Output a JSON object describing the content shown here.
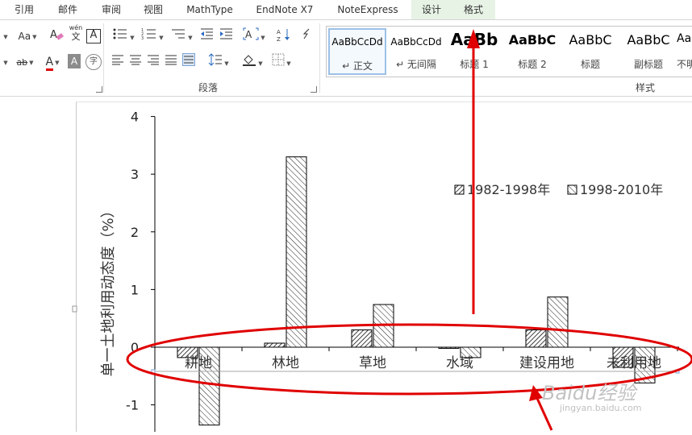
{
  "tabs": [
    "引用",
    "邮件",
    "审阅",
    "视图",
    "MathType",
    "EndNote X7",
    "NoteExpress",
    "设计",
    "格式"
  ],
  "ribbon": {
    "font_group": {
      "aa_label": "Aa",
      "phonetic_label": "wén",
      "phonetic_sub": "文",
      "border_char": "A",
      "highlight_label": "ab",
      "font_color_label": "A",
      "shade_char": "A",
      "enclose_char": "字"
    },
    "paragraph_group": {
      "label": "段落"
    },
    "styles_group": {
      "label": "样式",
      "items": [
        {
          "sample": "AaBbCcDd",
          "name": "↵ 正文"
        },
        {
          "sample": "AaBbCcDd",
          "name": "↵ 无间隔"
        },
        {
          "sample": "AaBb",
          "name": "标题 1"
        },
        {
          "sample": "AaBbC",
          "name": "标题 2"
        },
        {
          "sample": "AaBbC",
          "name": "标题"
        },
        {
          "sample": "AaBbC",
          "name": "副标题"
        },
        {
          "sample": "AaBl",
          "name": "不明"
        }
      ]
    }
  },
  "chart_data": {
    "type": "bar",
    "ylabel": "单一土地利用动态度（%）",
    "ylim": [
      -1.5,
      4
    ],
    "yticks": [
      4,
      3,
      2,
      1,
      0,
      -1
    ],
    "categories": [
      "耕地",
      "林地",
      "草地",
      "水域",
      "建设用地",
      "未利用地"
    ],
    "series": [
      {
        "name": "1982-1998年",
        "values": [
          -0.18,
          0.07,
          0.3,
          -0.02,
          0.3,
          -0.35
        ]
      },
      {
        "name": "1998-2010年",
        "values": [
          -1.35,
          3.3,
          0.74,
          -0.18,
          0.87,
          -0.62
        ]
      }
    ],
    "legend_position": "right"
  },
  "watermark": {
    "logo": "Baidu经验",
    "url": "jingyan.baidu.com"
  },
  "annotation_color": "#e00000"
}
